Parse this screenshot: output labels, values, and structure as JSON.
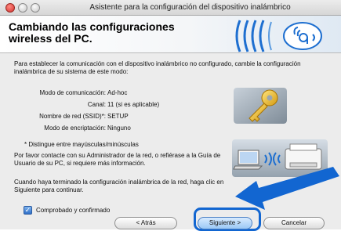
{
  "window": {
    "title": "Asistente para la configuración del dispositivo inalámbrico"
  },
  "header": {
    "title": "Cambiando las configuraciones wireless del PC."
  },
  "intro_text": "Para establecer la comunicación con el dispositivo inalámbrico no configurado, cambie la configuración inalámbrica de su sistema de este modo:",
  "settings": [
    {
      "label": "Modo de comunicación:",
      "value": "Ad-hoc"
    },
    {
      "label": "Canal:",
      "value": "11  (si es aplicable)"
    },
    {
      "label": "Nombre de red (SSID)*:",
      "value": "SETUP"
    },
    {
      "label": "Modo de encriptación:",
      "value": "Ninguno"
    }
  ],
  "note": "* Distingue entre mayúsculas/minúsculas",
  "contact_text": "Por favor contacte con su Administrador de la red, o refiérase a la Guía de Usuario de su PC, si requiere más información.",
  "finish_text": "Cuando haya terminado la configuración inalámbrica de la red, haga clic en Siguiente para continuar.",
  "checkbox": {
    "label": "Comprobado y confirmado",
    "checked": true
  },
  "buttons": {
    "back": "< Atrás",
    "next": "Siguiente >",
    "cancel": "Cancelar"
  },
  "icons": {
    "close": "close-icon",
    "minimize": "minimize-icon",
    "zoom": "zoom-icon",
    "wireless_logo": "wireless-logo-icon",
    "key": "key-icon",
    "printer_laptop": "laptop-printer-wireless-icon",
    "arrow": "arrow-pointer-icon"
  },
  "colors": {
    "accent": "#1266d1",
    "key": "#f2c233"
  }
}
